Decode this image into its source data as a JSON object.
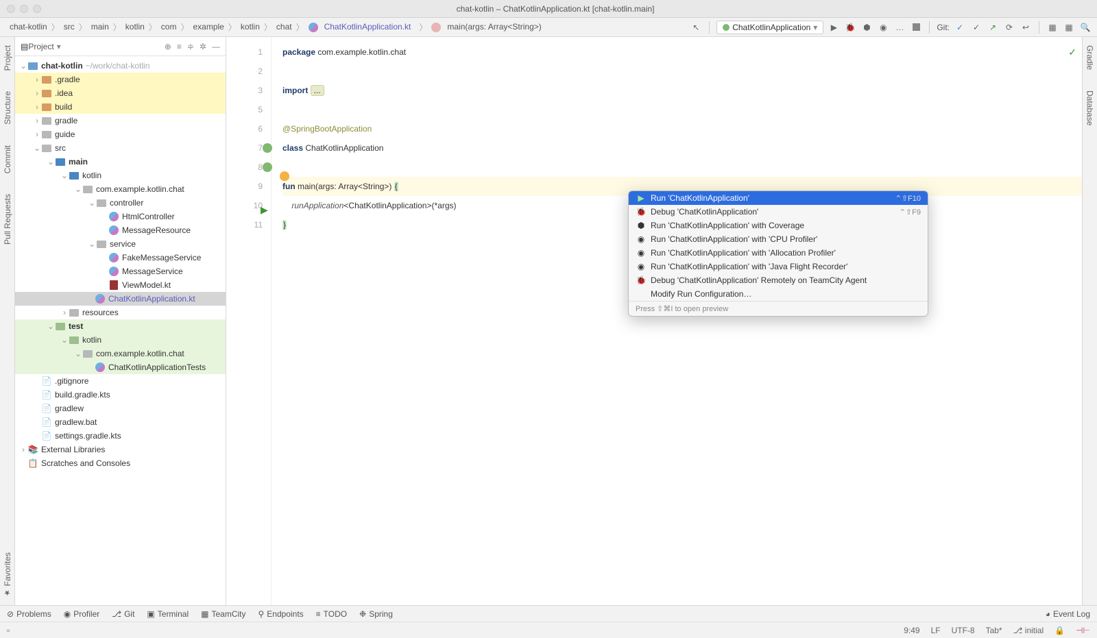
{
  "title": "chat-kotlin – ChatKotlinApplication.kt [chat-kotlin.main]",
  "breadcrumb": [
    "chat-kotlin",
    "src",
    "main",
    "kotlin",
    "com",
    "example",
    "kotlin",
    "chat"
  ],
  "breadcrumb_file": "ChatKotlinApplication.kt",
  "breadcrumb_func": "main(args: Array<String>)",
  "run_selector": "ChatKotlinApplication",
  "git_label": "Git:",
  "sidebar": {
    "title": "Project",
    "tree": {
      "root": "chat-kotlin",
      "root_path": "~/work/chat-kotlin",
      "gradle_dir": ".gradle",
      "idea_dir": ".idea",
      "build_dir": "build",
      "gradle": "gradle",
      "guide": "guide",
      "src": "src",
      "main": "main",
      "kotlin": "kotlin",
      "pkg": "com.example.kotlin.chat",
      "controller": "controller",
      "html_controller": "HtmlController",
      "message_resource": "MessageResource",
      "service": "service",
      "fake_message_service": "FakeMessageService",
      "message_service": "MessageService",
      "view_model": "ViewModel.kt",
      "app_file": "ChatKotlinApplication.kt",
      "resources": "resources",
      "test": "test",
      "test_kotlin": "kotlin",
      "test_pkg": "com.example.kotlin.chat",
      "test_file": "ChatKotlinApplicationTests",
      "gitignore": ".gitignore",
      "build_gradle": "build.gradle.kts",
      "gradlew": "gradlew",
      "gradlew_bat": "gradlew.bat",
      "settings_gradle": "settings.gradle.kts",
      "ext_lib": "External Libraries",
      "scratches": "Scratches and Consoles"
    }
  },
  "left_tools": [
    "Project",
    "Structure",
    "Commit",
    "Pull Requests"
  ],
  "left_bottom": "Favorites",
  "right_tools": [
    "Gradle",
    "Database"
  ],
  "editor": {
    "lines": [
      "1",
      "2",
      "3",
      "5",
      "6",
      "7",
      "8",
      "9",
      "10",
      "11"
    ],
    "l1_kw": "package",
    "l1_txt": " com.example.kotlin.chat",
    "l3_kw": "import",
    "l3_fold": "...",
    "l6": "@SpringBootApplication",
    "l7_kw": "class",
    "l7_txt": " ChatKotlinApplication",
    "l9_kw": "fun",
    "l9_name": " main",
    "l9_sig": "(args: Array<String>) ",
    "l9_brace": "{",
    "l10_it": "runApplication",
    "l10_txt": "<ChatKotlinApplication>(*args)",
    "l11_brace": "}"
  },
  "popup": {
    "items": [
      {
        "label": "Run 'ChatKotlinApplication'",
        "shortcut": "⌃⇧F10",
        "sel": true,
        "icon": "▶"
      },
      {
        "label": "Debug 'ChatKotlinApplication'",
        "shortcut": "⌃⇧F9",
        "icon": "🐞"
      },
      {
        "label": "Run 'ChatKotlinApplication' with Coverage",
        "icon": "⬢"
      },
      {
        "label": "Run 'ChatKotlinApplication' with 'CPU Profiler'",
        "icon": "◉"
      },
      {
        "label": "Run 'ChatKotlinApplication' with 'Allocation Profiler'",
        "icon": "◉"
      },
      {
        "label": "Run 'ChatKotlinApplication' with 'Java Flight Recorder'",
        "icon": "◉"
      },
      {
        "label": "Debug 'ChatKotlinApplication' Remotely on TeamCity Agent",
        "icon": "🐞"
      },
      {
        "label": "Modify Run Configuration…",
        "icon": ""
      }
    ],
    "footer": "Press ⇧⌘I to open preview"
  },
  "bottom": {
    "problems": "Problems",
    "profiler": "Profiler",
    "git": "Git",
    "terminal": "Terminal",
    "teamcity": "TeamCity",
    "endpoints": "Endpoints",
    "todo": "TODO",
    "spring": "Spring",
    "event_log": "Event Log"
  },
  "status": {
    "pos": "9:49",
    "lf": "LF",
    "enc": "UTF-8",
    "tab": "Tab*",
    "branch": "initial"
  }
}
